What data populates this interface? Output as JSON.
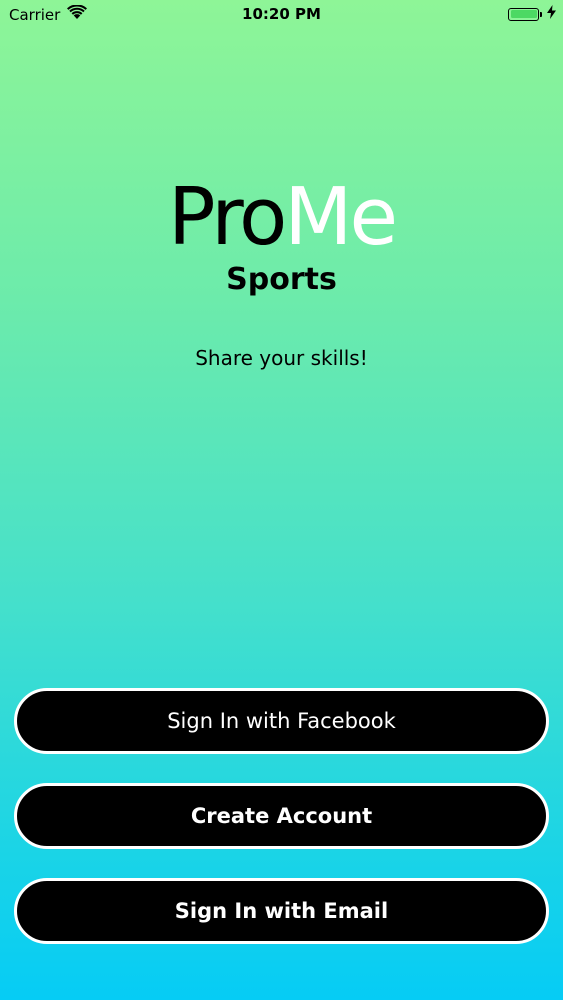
{
  "status_bar": {
    "carrier": "Carrier",
    "time": "10:20 PM",
    "battery_level": 1.0,
    "battery_color": "#4cd964"
  },
  "logo": {
    "part1": "Pro",
    "part2": "Me",
    "part1_color": "#000000",
    "part2_color": "#ffffff"
  },
  "subtitle": "Sports",
  "tagline": "Share your skills!",
  "buttons": {
    "facebook": "Sign In with Facebook",
    "create_account": "Create Account",
    "email": "Sign In with Email"
  },
  "colors": {
    "gradient_top": "#8ef597",
    "gradient_bottom": "#06ccf5",
    "button_bg": "#000000",
    "button_border": "#ffffff"
  }
}
